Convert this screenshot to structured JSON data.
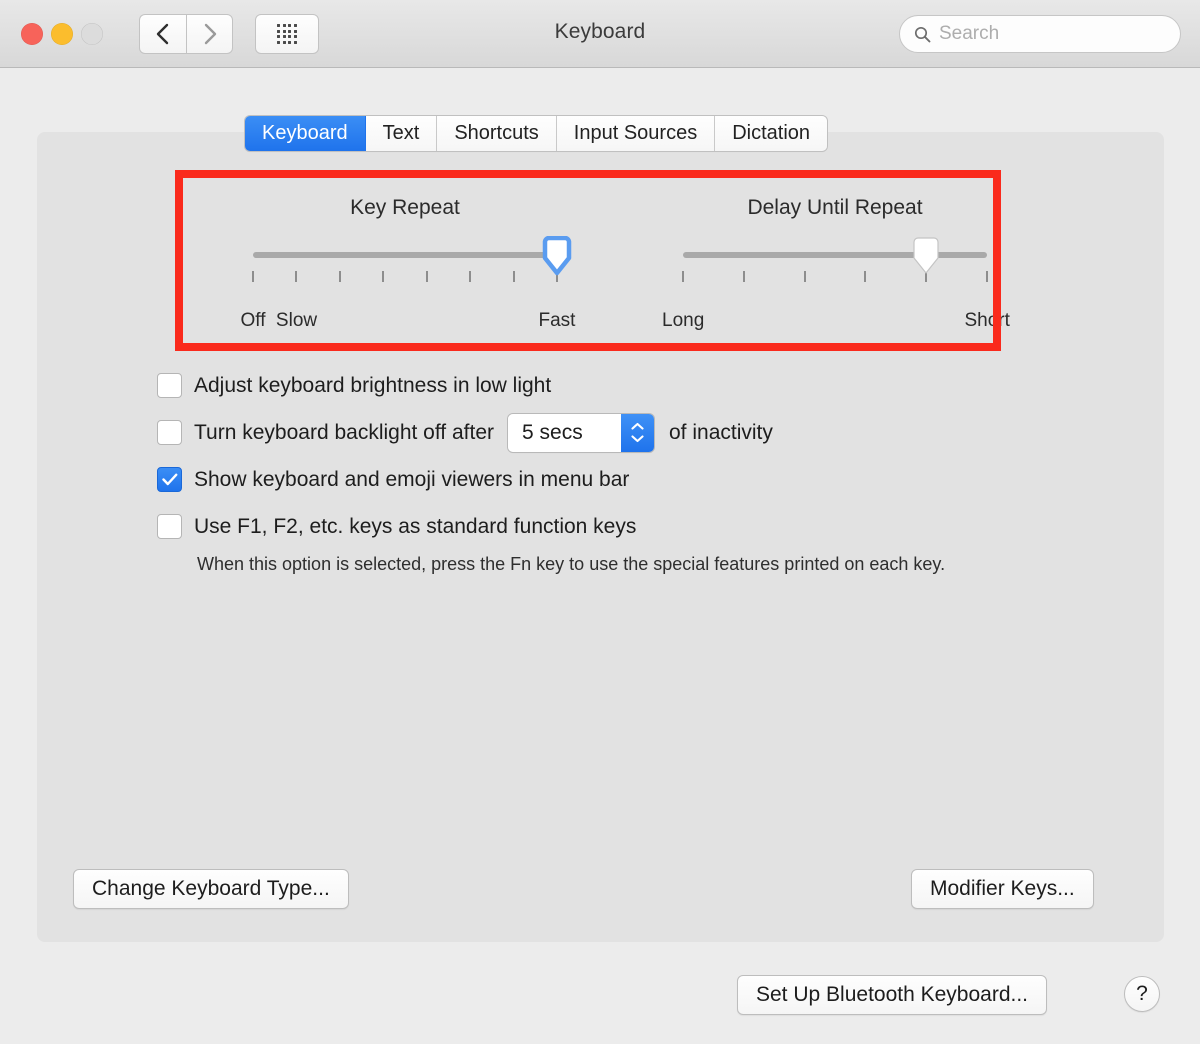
{
  "window": {
    "title": "Keyboard",
    "traffic_lights": [
      {
        "name": "close",
        "color": "#f7635a"
      },
      {
        "name": "minimize",
        "color": "#fbbd2d"
      },
      {
        "name": "zoom",
        "color": "#dcdcdc"
      }
    ],
    "nav": {
      "back_icon": "chevron-left-icon",
      "forward_icon": "chevron-right-icon",
      "grid_icon": "show-all-grid-icon"
    },
    "search": {
      "placeholder": "Search",
      "value": "",
      "icon": "search-icon"
    }
  },
  "tabs": [
    {
      "label": "Keyboard",
      "active": true
    },
    {
      "label": "Text",
      "active": false
    },
    {
      "label": "Shortcuts",
      "active": false
    },
    {
      "label": "Input Sources",
      "active": false
    },
    {
      "label": "Dictation",
      "active": false
    }
  ],
  "highlight": {
    "color": "#fa2a1c",
    "border_width": 8
  },
  "sliders": [
    {
      "id": "key-repeat",
      "title": "Key Repeat",
      "ticks": 8,
      "value_index": 7,
      "focused": true,
      "labels": [
        {
          "text": "Off",
          "tick": 0
        },
        {
          "text": "Slow",
          "tick": 1
        },
        {
          "text": "Fast",
          "tick": 7
        }
      ]
    },
    {
      "id": "delay-until-repeat",
      "title": "Delay Until Repeat",
      "ticks": 6,
      "value_index": 4,
      "focused": false,
      "labels": [
        {
          "text": "Long",
          "tick": 0
        },
        {
          "text": "Short",
          "tick": 5
        }
      ]
    }
  ],
  "options": [
    {
      "id": "adjust-brightness",
      "checked": false,
      "label": "Adjust keyboard brightness in low light"
    },
    {
      "id": "backlight-off",
      "checked": false,
      "label": "Turn keyboard backlight off after",
      "stepper_value": "5 secs",
      "suffix": "of inactivity"
    },
    {
      "id": "show-viewers",
      "checked": true,
      "label": "Show keyboard and emoji viewers in menu bar"
    },
    {
      "id": "standard-function-keys",
      "checked": false,
      "label": "Use F1, F2, etc. keys as standard function keys",
      "helper": "When this option is selected, press the Fn key to use the special features printed on each key."
    }
  ],
  "buttons": {
    "change_keyboard_type": "Change Keyboard Type...",
    "modifier_keys": "Modifier Keys...",
    "setup_bluetooth": "Set Up Bluetooth Keyboard...",
    "help": "?"
  },
  "colors": {
    "accent": "#1f73ec",
    "window_bg": "#ececec",
    "panel_bg": "#e2e2e2",
    "highlight": "#fa2a1c"
  }
}
